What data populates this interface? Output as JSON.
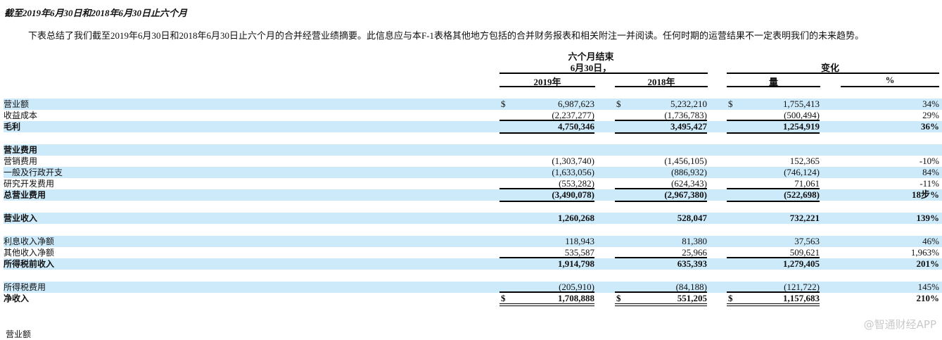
{
  "title": "截至2019年6月30日和2018年6月30日止六个月",
  "intro": "下表总结了我们截至2019年6月30日和2018年6月30日止六个月的合并经营业绩摘要。此信息应与本F-1表格其他地方包括的合并财务报表和相关附注一并阅读。任何时期的运营结果不一定表明我们的未来趋势。",
  "header": {
    "period_line1": "六个月结束",
    "period_line2": "6月30日，",
    "change": "变化",
    "col_2019": "2019年",
    "col_2018": "2018年",
    "col_amount": "量",
    "col_pct": "%"
  },
  "rows": [
    {
      "label": "营业额",
      "v2019": "6,987,623",
      "v2018": "5,232,210",
      "chg": "1,755,413",
      "pct": "34%",
      "dollar": true,
      "style": "blue"
    },
    {
      "label": "收益成本",
      "v2019": "(2,237,277)",
      "v2018": "(1,736,783)",
      "chg": "(500,494)",
      "pct": "29%"
    },
    {
      "label": "毛利",
      "v2019": "4,750,346",
      "v2018": "3,495,427",
      "chg": "1,254,919",
      "pct": "36%",
      "bold": true,
      "style": "blue",
      "lines": "top-bottom"
    },
    {
      "gap": true
    },
    {
      "label": "营业费用",
      "v2019": "",
      "v2018": "",
      "chg": "",
      "pct": "",
      "bold": true,
      "style": "blue"
    },
    {
      "label": "营销费用",
      "v2019": "(1,303,740)",
      "v2018": "(1,456,105)",
      "chg": "152,365",
      "pct": "-10%"
    },
    {
      "label": "一般及行政开支",
      "v2019": "(1,633,056)",
      "v2018": "(886,932)",
      "chg": "(746,124)",
      "pct": "84%",
      "style": "blue"
    },
    {
      "label": "研究开发费用",
      "v2019": "(553,282)",
      "v2018": "(624,343)",
      "chg": "71,061",
      "pct": "-11%"
    },
    {
      "label": "总营业费用",
      "v2019": "(3,490,078)",
      "v2018": "(2,967,380)",
      "chg": "(522,698)",
      "pct": "18步%",
      "bold": true,
      "style": "blue",
      "lines": "top-bottom"
    },
    {
      "gap": true
    },
    {
      "label": "营业收入",
      "v2019": "1,260,268",
      "v2018": "528,047",
      "chg": "732,221",
      "pct": "139%",
      "bold": true,
      "style": "blue"
    },
    {
      "gap": true
    },
    {
      "label": "利息收入净额",
      "v2019": "118,943",
      "v2018": "81,380",
      "chg": "37,563",
      "pct": "46%",
      "style": "blue"
    },
    {
      "label": "其他收入净额",
      "v2019": "535,587",
      "v2018": "25,966",
      "chg": "509,621",
      "pct": "1,963%"
    },
    {
      "label": "所得税前收入",
      "v2019": "1,914,798",
      "v2018": "635,393",
      "chg": "1,279,405",
      "pct": "201%",
      "bold": true,
      "style": "blue",
      "lines": "top"
    },
    {
      "gap": true
    },
    {
      "label": "所得税费用",
      "v2019": "(205,910)",
      "v2018": "(84,188)",
      "chg": "(121,722)",
      "pct": "145%",
      "style": "blue"
    },
    {
      "label": "净收入",
      "v2019": "1,708,888",
      "v2018": "551,205",
      "chg": "1,157,683",
      "pct": "210%",
      "bold": true,
      "dollar": true,
      "lines": "top-double"
    }
  ],
  "currency_symbol": "$",
  "watermark": "@智通财经APP",
  "cut_off_label": "营业额"
}
